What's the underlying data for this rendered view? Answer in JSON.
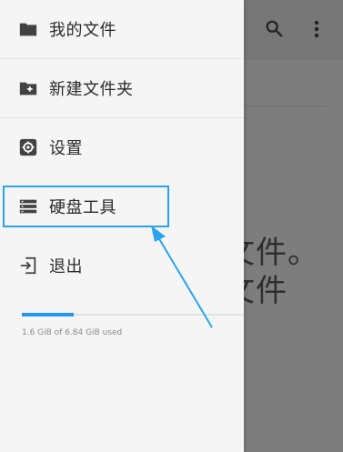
{
  "background": {
    "line1": "文件。",
    "line2": "文件",
    "icons": [
      "search-icon",
      "more-vert-icon"
    ]
  },
  "drawer": {
    "items": [
      {
        "label": "我的文件",
        "icon": "folder-icon"
      },
      {
        "label": "新建文件夹",
        "icon": "folder-add-icon"
      },
      {
        "label": "设置",
        "icon": "gear-icon"
      },
      {
        "label": "硬盘工具",
        "icon": "storage-icon"
      },
      {
        "label": "退出",
        "icon": "exit-icon"
      }
    ],
    "storage": {
      "text": "1.6 GiB of 6.84 GiB used",
      "used_fraction": 0.234
    }
  },
  "annotation": {
    "color": "#29a3ef",
    "target": "硬盘工具"
  }
}
